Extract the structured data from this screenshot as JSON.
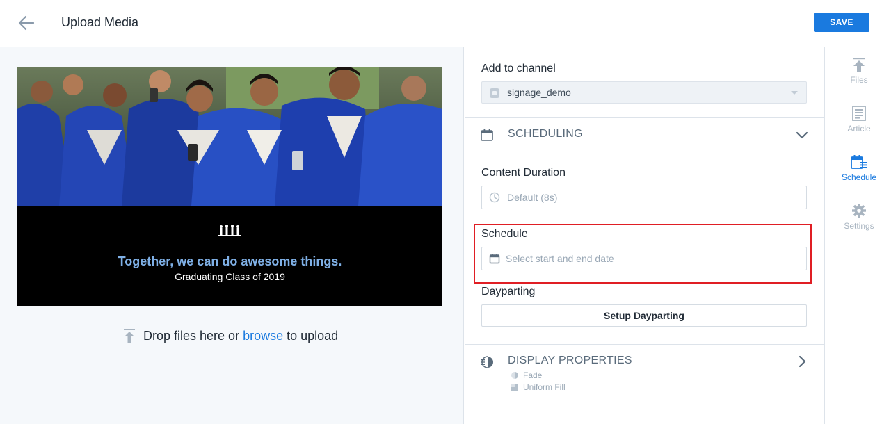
{
  "header": {
    "title": "Upload Media",
    "save_label": "SAVE"
  },
  "preview": {
    "headline": "Together, we can do awesome things.",
    "subline": "Graduating Class of 2019"
  },
  "drop_zone": {
    "text_before": "Drop files here or",
    "link": "browse",
    "text_after": "to upload"
  },
  "form": {
    "channel_label": "Add to channel",
    "channel_value": "signage_demo",
    "scheduling_title": "SCHEDULING",
    "duration_label": "Content Duration",
    "duration_placeholder": "Default (8s)",
    "schedule_label": "Schedule",
    "schedule_placeholder": "Select start and end date",
    "dayparting_label": "Dayparting",
    "dayparting_button": "Setup Dayparting",
    "display_title": "DISPLAY PROPERTIES",
    "display_items": [
      "Fade",
      "Uniform Fill"
    ]
  },
  "nav": {
    "items": [
      {
        "label": "Files",
        "icon": "upload-icon",
        "active": false
      },
      {
        "label": "Article",
        "icon": "article-icon",
        "active": false
      },
      {
        "label": "Schedule",
        "icon": "schedule-icon",
        "active": true
      },
      {
        "label": "Settings",
        "icon": "gear-icon",
        "active": false
      }
    ]
  },
  "colors": {
    "accent": "#1a7adf",
    "highlight": "#e01e24",
    "caption_headline": "#7fb0e6"
  }
}
